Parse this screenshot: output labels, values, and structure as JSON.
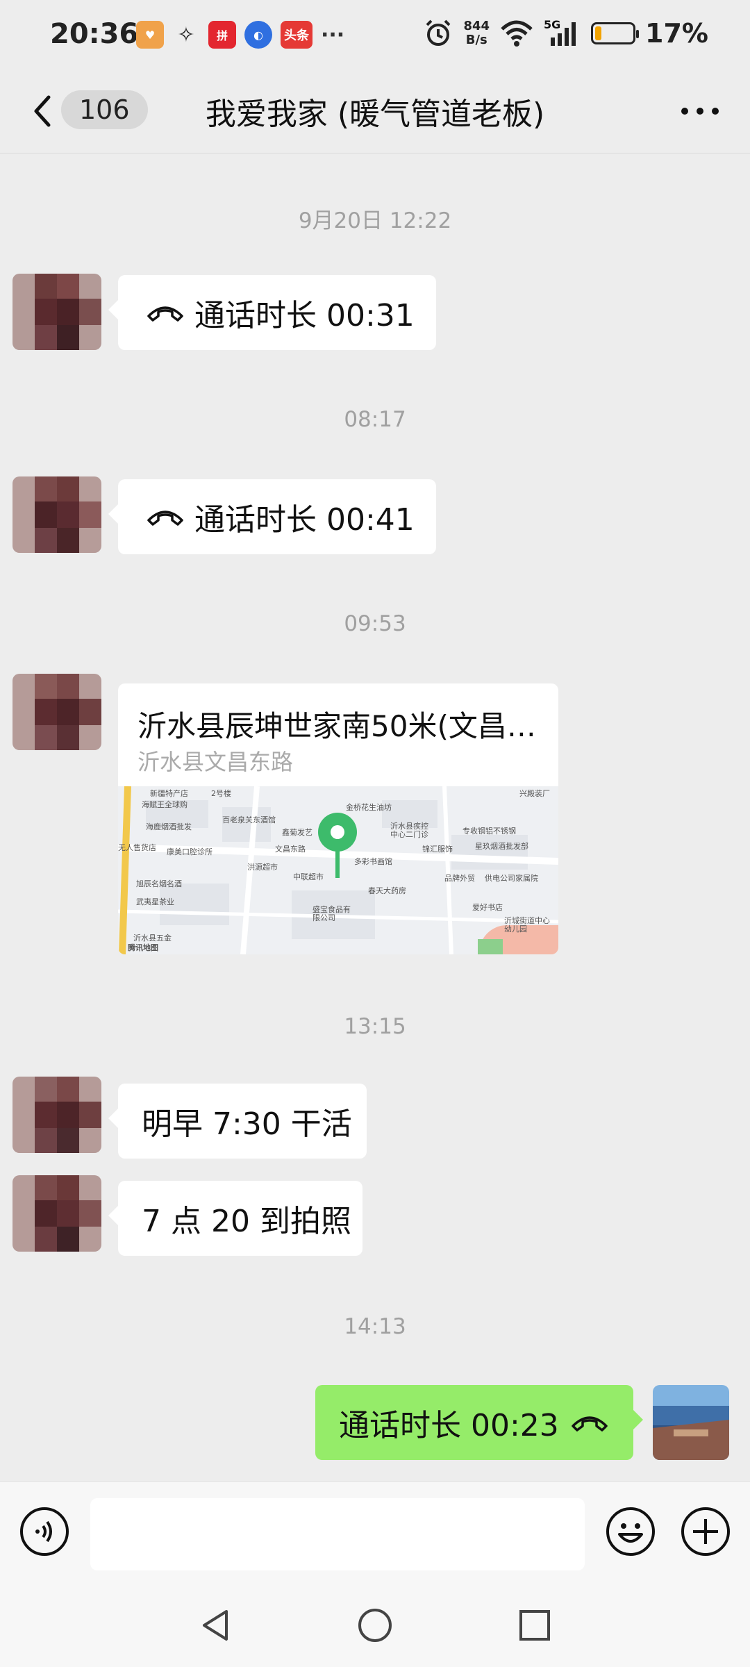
{
  "status_bar": {
    "time": "20:36",
    "net_speed_value": "844",
    "net_speed_unit": "B/s",
    "signal": "5G",
    "battery_percent": "17%",
    "battery_level": 0.17,
    "app_icon_toutiao": "头条",
    "more": "···"
  },
  "header": {
    "unread_count": "106",
    "title": "我爱我家 (暖气管道老板)"
  },
  "messages": [
    {
      "type": "timestamp",
      "text": "9月20日 12:22"
    },
    {
      "type": "call",
      "from": "other",
      "text": "通话时长 00:31"
    },
    {
      "type": "timestamp",
      "text": "08:17"
    },
    {
      "type": "call",
      "from": "other",
      "text": "通话时长 00:41"
    },
    {
      "type": "timestamp",
      "text": "09:53"
    },
    {
      "type": "location",
      "from": "other",
      "title": "沂水县辰坤世家南50米(文昌…",
      "subtitle": "沂水县文昌东路",
      "map_labels": [
        "新疆特产店",
        "海赋王全球购",
        "海鹿烟酒批发",
        "无人售货店",
        "康美口腔诊所",
        "旭辰名烟名酒",
        "武夷星茶业",
        "沂水县五金",
        "百老泉关东酒馆",
        "鑫菊发艺",
        "洪源超市",
        "中联超市",
        "文昌东路",
        "金桥花生油坊",
        "沂水县疾控中心二门诊",
        "多彩书画馆",
        "锦汇服饰",
        "春天大药房",
        "品牌外贸",
        "盛宝食品有限公司",
        "兴殿装厂",
        "专收钢铝不锈钢",
        "星玖烟酒批发部",
        "供电公司家属院",
        "爱好书店",
        "沂城街道中心幼儿园",
        "腾讯地图",
        "2号楼"
      ]
    },
    {
      "type": "timestamp",
      "text": "13:15"
    },
    {
      "type": "text",
      "from": "other",
      "text": "明早 7:30 干活"
    },
    {
      "type": "text",
      "from": "other",
      "text": "7 点 20 到拍照"
    },
    {
      "type": "timestamp",
      "text": "14:13"
    },
    {
      "type": "call",
      "from": "me",
      "text": "通话时长 00:23"
    }
  ],
  "input": {
    "placeholder": "",
    "value": ""
  },
  "colors": {
    "background": "#ededed",
    "my_bubble": "#95ec69",
    "bubble": "#ffffff",
    "pin": "#3dbb6b"
  }
}
